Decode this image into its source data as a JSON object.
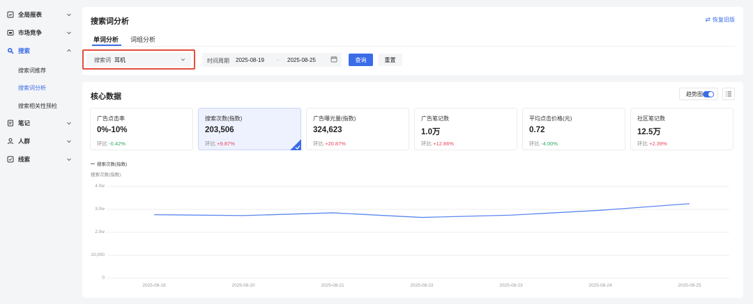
{
  "sidebar": {
    "items": [
      {
        "label": "全局报表",
        "icon": "report-icon",
        "expanded": false
      },
      {
        "label": "市场竞争",
        "icon": "market-icon",
        "expanded": false
      },
      {
        "label": "搜索",
        "icon": "search-icon",
        "expanded": true,
        "children": [
          {
            "label": "搜索词推荐",
            "active": false
          },
          {
            "label": "搜索词分析",
            "active": true
          },
          {
            "label": "搜索相关性预检",
            "active": false
          }
        ]
      },
      {
        "label": "笔记",
        "icon": "note-icon",
        "expanded": false
      },
      {
        "label": "人群",
        "icon": "people-icon",
        "expanded": false
      },
      {
        "label": "线索",
        "icon": "lead-icon",
        "expanded": false
      }
    ]
  },
  "header": {
    "title": "搜索词分析",
    "restore_label": "恢复旧版",
    "tabs": [
      {
        "label": "单词分析",
        "active": true
      },
      {
        "label": "词组分析",
        "active": false
      }
    ]
  },
  "filters": {
    "keyword_label": "搜索词",
    "keyword_value": "耳机",
    "period_label": "时间周期",
    "start_date": "2025-08-19",
    "end_date": "2025-08-25",
    "date_separator": "~",
    "query_button": "查询",
    "reset_button": "重置"
  },
  "core": {
    "title": "核心数据",
    "trend_label": "趋势图",
    "trend_enabled": true,
    "metrics": [
      {
        "label": "广告点击率",
        "value": "0%-10%",
        "ratio_label": "环比",
        "ratio": "-0.42%",
        "direction": "down",
        "selected": false
      },
      {
        "label": "搜索次数(指数)",
        "value": "203,506",
        "ratio_label": "环比",
        "ratio": "+9.87%",
        "direction": "up",
        "selected": true
      },
      {
        "label": "广告曝光量(指数)",
        "value": "324,623",
        "ratio_label": "环比",
        "ratio": "+20.87%",
        "direction": "up",
        "selected": false
      },
      {
        "label": "广告笔记数",
        "value": "1.0万",
        "ratio_label": "环比",
        "ratio": "+12.86%",
        "direction": "up",
        "selected": false
      },
      {
        "label": "平均点击价格(元)",
        "value": "0.72",
        "ratio_label": "环比",
        "ratio": "-4.00%",
        "direction": "down",
        "selected": false
      },
      {
        "label": "社区笔记数",
        "value": "12.5万",
        "ratio_label": "环比",
        "ratio": "+2.39%",
        "direction": "up",
        "selected": false
      }
    ]
  },
  "colors": {
    "accent": "#3b6ce8",
    "up": "#e8455a",
    "down": "#2fa861",
    "highlight_border": "#e24e3b"
  },
  "chart_data": {
    "type": "line",
    "legend": "搜索次数(指数)",
    "ylabel": "搜索次数(指数)",
    "ylim": [
      0,
      40000
    ],
    "yticks": [
      0,
      10000,
      20000,
      30000,
      40000
    ],
    "ytick_labels": [
      "0",
      "10,000",
      "2.0w",
      "3.0w",
      "4.0w"
    ],
    "x": [
      "2025-08-19",
      "2025-08-20",
      "2025-08-21",
      "2025-08-22",
      "2025-08-23",
      "2025-08-24",
      "2025-08-25"
    ],
    "series": [
      {
        "name": "搜索次数(指数)",
        "values": [
          27700,
          27300,
          28500,
          26500,
          27500,
          29600,
          32500
        ]
      }
    ],
    "grid": true,
    "legend_position": "top-left"
  }
}
